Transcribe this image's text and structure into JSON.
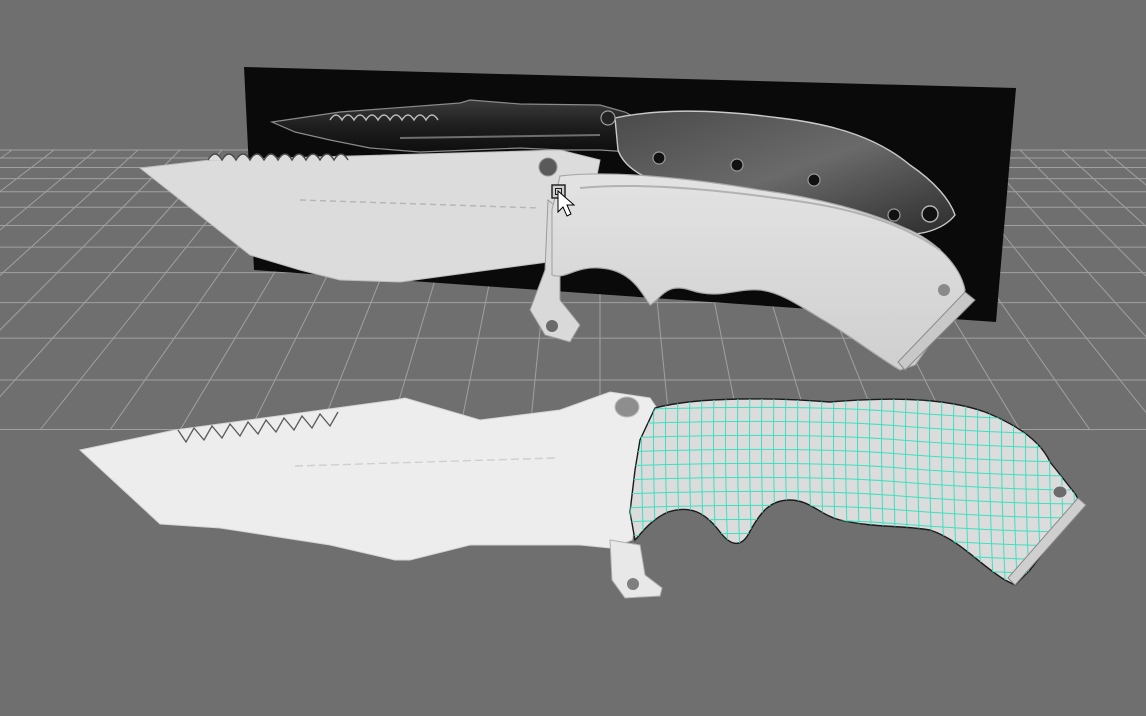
{
  "viewport": {
    "background_color": "#6f6f6f",
    "grid_color": "#a9a9a9",
    "reference_plane_color": "#090909"
  },
  "scene": {
    "objects": [
      {
        "name": "reference-image-plane",
        "kind": "image-plane"
      },
      {
        "name": "blade-highpoly",
        "kind": "mesh"
      },
      {
        "name": "blade-lowpoly",
        "kind": "mesh"
      }
    ],
    "selected_object": "blade-lowpoly",
    "wireframe_color": "#3fe0c0",
    "mesh_color": "#e9e9e9"
  },
  "cursor": {
    "icon": "arrow-cursor-icon",
    "tool_icon": "select-object-icon"
  }
}
